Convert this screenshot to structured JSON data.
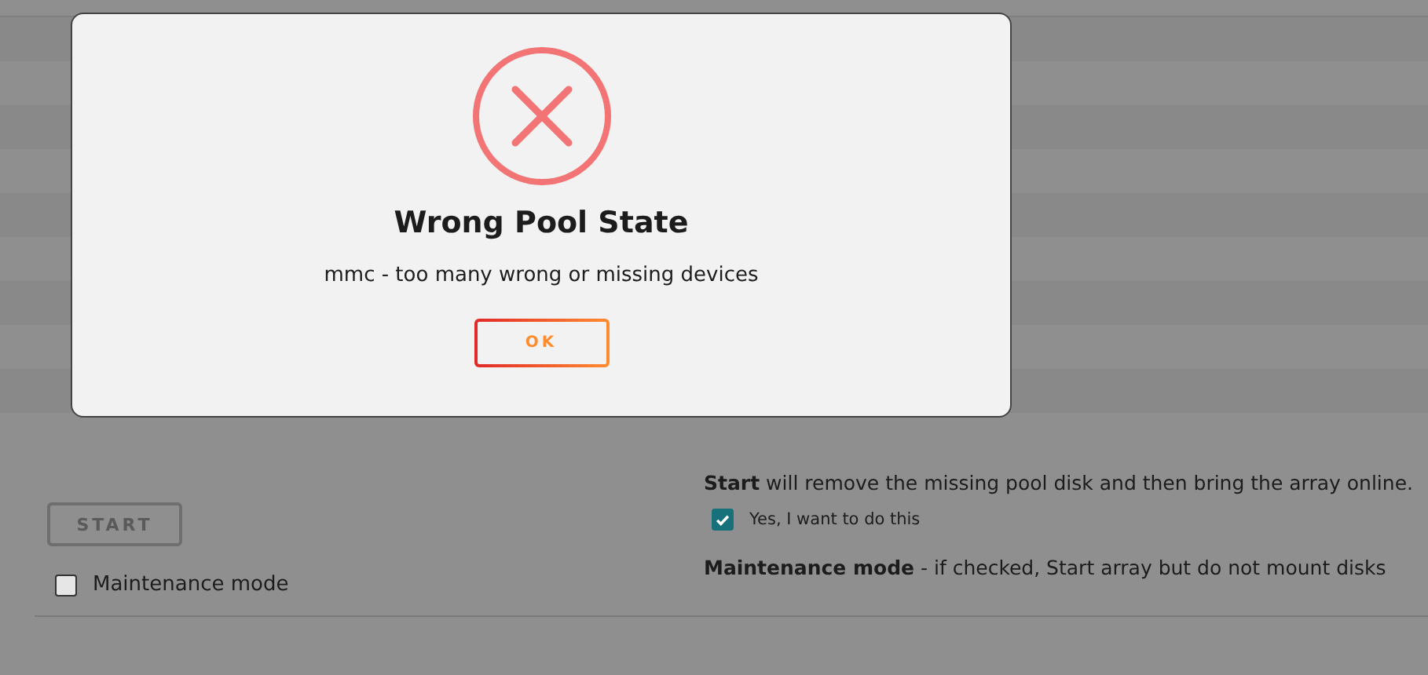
{
  "dialog": {
    "title": "Wrong Pool State",
    "message": "mmc - too many wrong or missing devices",
    "button": "OK"
  },
  "array_operation": {
    "start_button": {
      "label": "START",
      "disabled": true
    },
    "start_note": "**Start** will remove the missing pool disk and then bring the array online.",
    "confirm": {
      "label": "Yes, I want to do this",
      "checked": true
    },
    "maintenance": {
      "label": "Maintenance mode",
      "checked": false
    },
    "maintenance_note": "**Maintenance mode** - if checked, Start array but do not mount disks"
  }
}
